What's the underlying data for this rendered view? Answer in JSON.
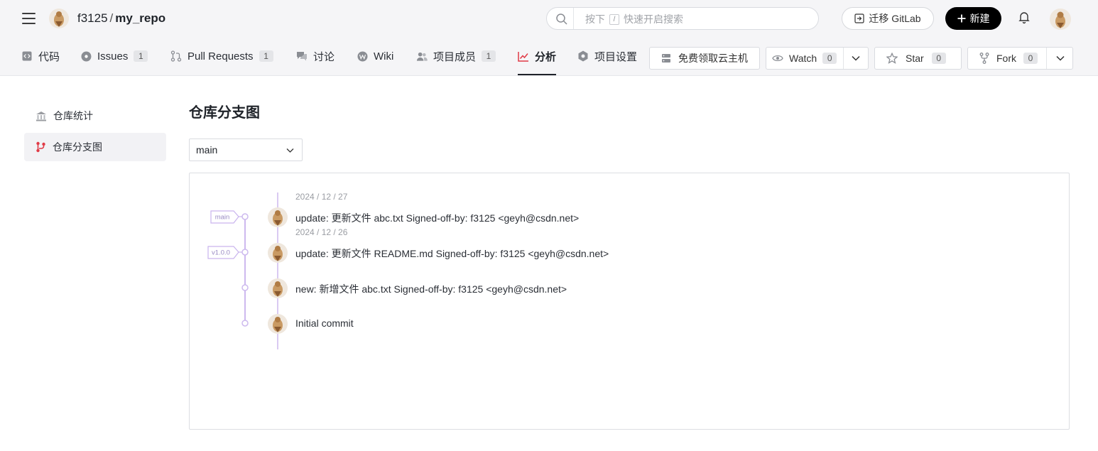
{
  "header": {
    "owner": "f3125",
    "separator": "/",
    "repo": "my_repo",
    "search": {
      "prefix": "按下",
      "key": "/",
      "suffix": "快速开启搜索"
    },
    "migrate_label": "迁移 GitLab",
    "new_label": "新建"
  },
  "nav": {
    "tabs": [
      {
        "label": "代码",
        "icon": "code-icon"
      },
      {
        "label": "Issues",
        "count": "1",
        "icon": "issues-icon"
      },
      {
        "label": "Pull Requests",
        "count": "1",
        "icon": "pull-request-icon"
      },
      {
        "label": "讨论",
        "icon": "discussion-icon"
      },
      {
        "label": "Wiki",
        "icon": "wiki-icon"
      },
      {
        "label": "项目成员",
        "count": "1",
        "icon": "members-icon"
      },
      {
        "label": "分析",
        "icon": "analytics-icon",
        "active": true
      },
      {
        "label": "项目设置",
        "icon": "settings-icon"
      }
    ],
    "cloud_label": "免费领取云主机",
    "watch": {
      "label": "Watch",
      "count": "0"
    },
    "star": {
      "label": "Star",
      "count": "0"
    },
    "fork": {
      "label": "Fork",
      "count": "0"
    }
  },
  "sidebar": {
    "items": [
      {
        "label": "仓库统计",
        "icon": "repo-stats-icon"
      },
      {
        "label": "仓库分支图",
        "icon": "branch-graph-icon",
        "active": true
      }
    ]
  },
  "main": {
    "title": "仓库分支图",
    "branch_selected": "main"
  },
  "graph": {
    "commits": [
      {
        "date": "2024 / 12 / 27",
        "message": "update: 更新文件 abc.txt Signed-off-by: f3125 <geyh@csdn.net>",
        "ref": "main"
      },
      {
        "date": "2024 / 12 / 26",
        "message": "update: 更新文件 README.md Signed-off-by: f3125 <geyh@csdn.net>",
        "ref": "v1.0.0"
      },
      {
        "date": "",
        "message": "new: 新增文件 abc.txt Signed-off-by: f3125 <geyh@csdn.net>",
        "ref": ""
      },
      {
        "date": "",
        "message": "Initial commit",
        "ref": ""
      }
    ]
  },
  "colors": {
    "graph_line": "#c9b4ee",
    "accent_red": "#e03a46",
    "primary_black": "#000000"
  }
}
